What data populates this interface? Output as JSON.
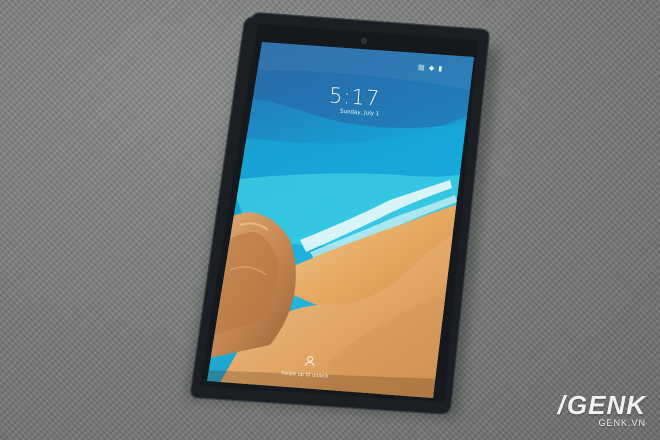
{
  "lock_screen": {
    "status_icons": "▤ ◆ ▮",
    "time": "5:17",
    "date": "Sunday, July 1",
    "unlock_hint": "Swipe up to unlock"
  },
  "watermark": {
    "logo": "GENK",
    "url": "GENK.VN"
  },
  "colors": {
    "background_fabric": "#7f8181",
    "tablet_bezel": "#1a1d22",
    "ocean": "#1aa9d6",
    "sand": "#e9b06a",
    "rocks": "#c98a55"
  }
}
